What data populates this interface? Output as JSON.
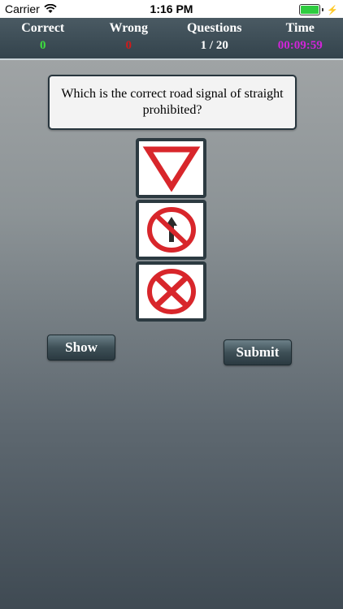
{
  "status": {
    "carrier": "Carrier",
    "time": "1:16 PM"
  },
  "stats": {
    "correct": {
      "label": "Correct",
      "value": "0"
    },
    "wrong": {
      "label": "Wrong",
      "value": "0"
    },
    "questions": {
      "label": "Questions",
      "value": "1 / 20"
    },
    "time": {
      "label": "Time",
      "value": "00:09:59"
    }
  },
  "colors": {
    "correct": "#3ee03e",
    "wrong": "#d11a1a",
    "time": "#d025d8",
    "questions": "#ffffff",
    "sign_red": "#d8262b"
  },
  "question": {
    "text": "Which is the correct road signal of straight prohibited?"
  },
  "options": [
    {
      "icon": "yield-sign-icon"
    },
    {
      "icon": "no-straight-ahead-sign-icon"
    },
    {
      "icon": "no-stopping-sign-icon"
    }
  ],
  "buttons": {
    "show": "Show",
    "submit": "Submit"
  }
}
